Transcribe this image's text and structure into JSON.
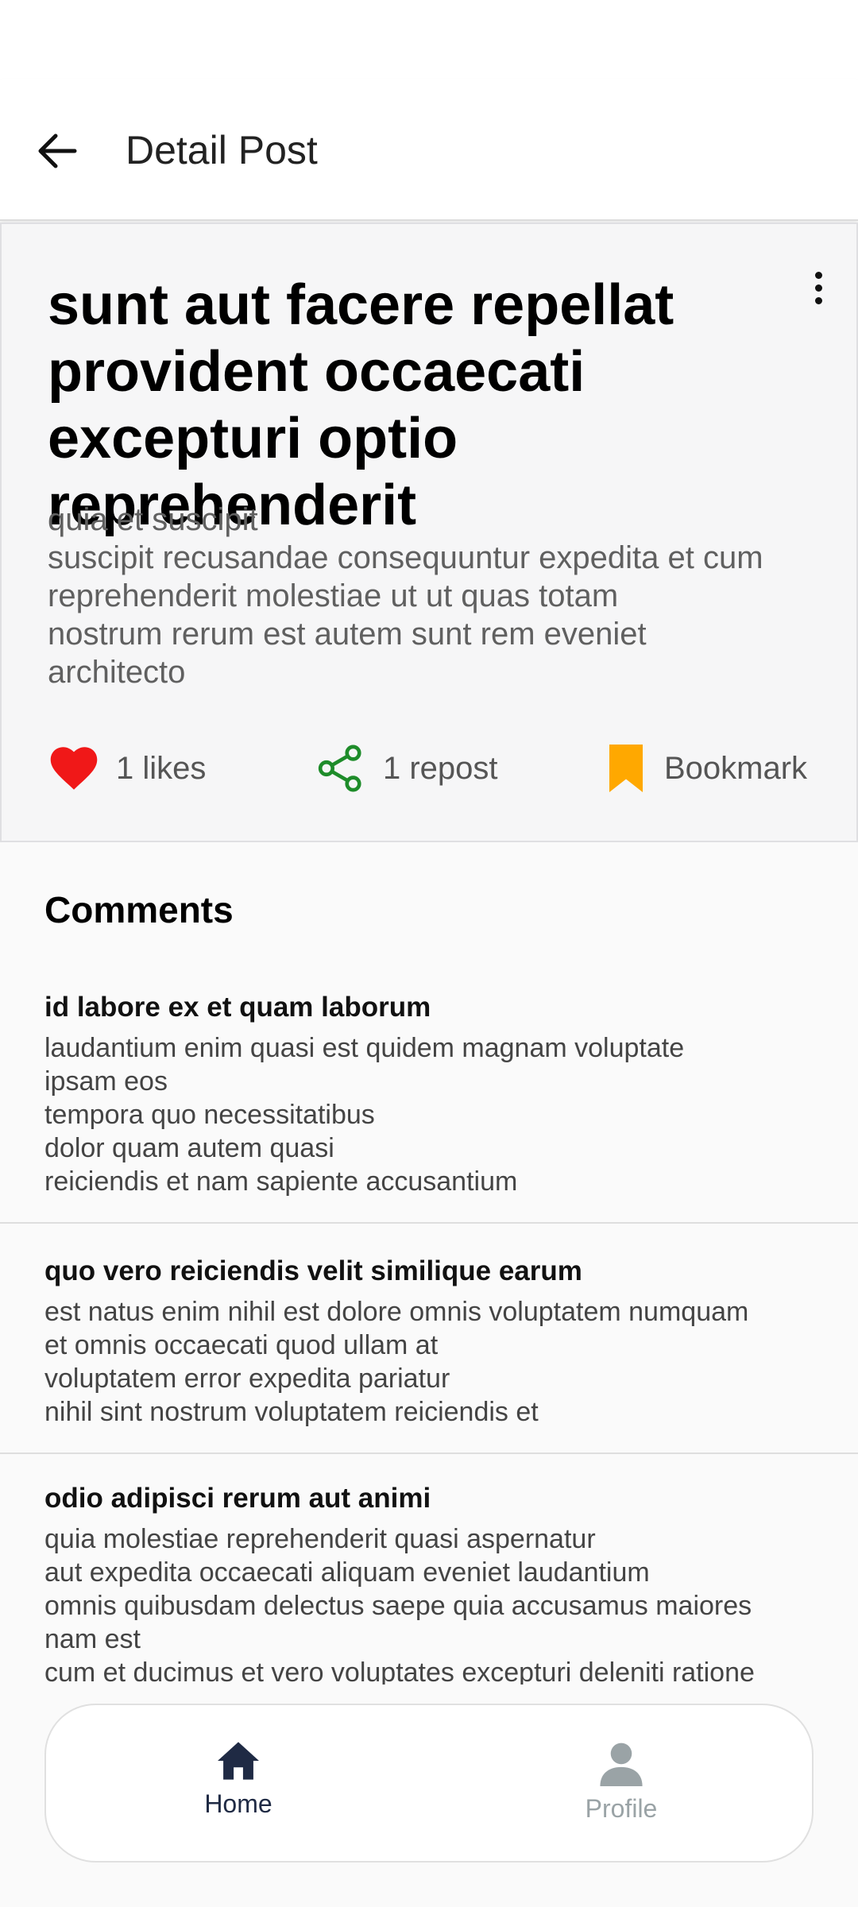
{
  "app_bar": {
    "title": "Detail Post",
    "back_icon": "arrow-left-icon"
  },
  "post": {
    "title": "sunt aut facere repellat provident occaecati excepturi optio reprehenderit",
    "body": "quia et suscipit\nsuscipit recusandae consequuntur expedita et cum\nreprehenderit molestiae ut ut quas totam\nnostrum rerum est autem sunt rem eveniet\narchitecto",
    "menu_icon": "more-vertical-icon",
    "actions": {
      "likes_label": "1 likes",
      "repost_label": "1 repost",
      "bookmark_label": "Bookmark"
    }
  },
  "comments": {
    "heading": "Comments",
    "items": [
      {
        "title": "id labore ex et quam laborum",
        "body": "laudantium enim quasi est quidem magnam voluptate\nipsam eos\ntempora quo necessitatibus\ndolor quam autem quasi\nreiciendis et nam sapiente accusantium"
      },
      {
        "title": "quo vero reiciendis velit similique earum",
        "body": "est natus enim nihil est dolore omnis voluptatem numquam\net omnis occaecati quod ullam at\nvoluptatem error expedita pariatur\nnihil sint nostrum voluptatem reiciendis et"
      },
      {
        "title": "odio adipisci rerum aut animi",
        "body": "quia molestiae reprehenderit quasi aspernatur\naut expedita occaecati aliquam eveniet laudantium\nomnis quibusdam delectus saepe quia accusamus maiores\nnam est\ncum et ducimus et vero voluptates excepturi deleniti ratione"
      }
    ]
  },
  "bottom_nav": {
    "home_label": "Home",
    "profile_label": "Profile"
  },
  "colors": {
    "like": "#f01818",
    "repost": "#1e8c2a",
    "bookmark": "#ffa800",
    "nav_active": "#1f2a44",
    "nav_inactive": "#9aa3a6"
  }
}
